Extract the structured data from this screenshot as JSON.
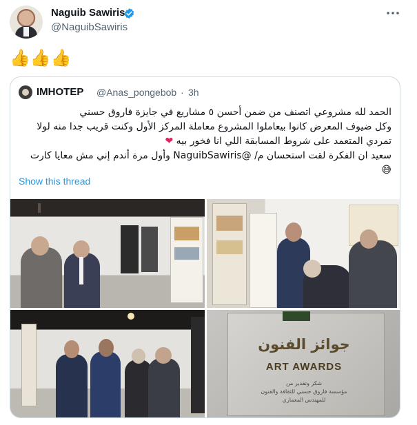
{
  "tweet": {
    "author_name": "Naguib Sawiris",
    "author_handle": "@NaguibSawiris",
    "emoji_text": "👍👍👍"
  },
  "quote": {
    "name": "IMHOTEP",
    "handle": "@Anas_pongebob",
    "separator": "·",
    "time": "3h",
    "lines": [
      "الحمد لله مشروعي اتصنف من ضمن أحسن ٥ مشاريع في جايزة فاروق حسني",
      "وكل ضيوف المعرض كانوا بيعاملوا المشروع معاملة المركز الأول وكنت قريب جدا منه لولا",
      "تمردي المتعمد على شروط المسابقة اللي انا فخور بيه",
      "سعيد ان الفكرة لقت استحسان م/ @NaguibSawiris وأول مرة أندم إني مش معايا كارت",
      "😅"
    ],
    "heart": "❤",
    "show_thread": "Show this thread"
  },
  "photos": {
    "award_arabic": "جوائز الفنون",
    "award_english": "ART AWARDS",
    "award_sub_1": "شكر وتقدير من",
    "award_sub_2": "مؤسسة فاروق حسني للثقافة والفنون",
    "award_sub_3": "للمهندس المعماري"
  },
  "colors": {
    "link": "#1d9bf0",
    "verified": "#1d9bf0",
    "heart": "#e0245e",
    "muted": "#536471",
    "border": "#cfd9de"
  }
}
